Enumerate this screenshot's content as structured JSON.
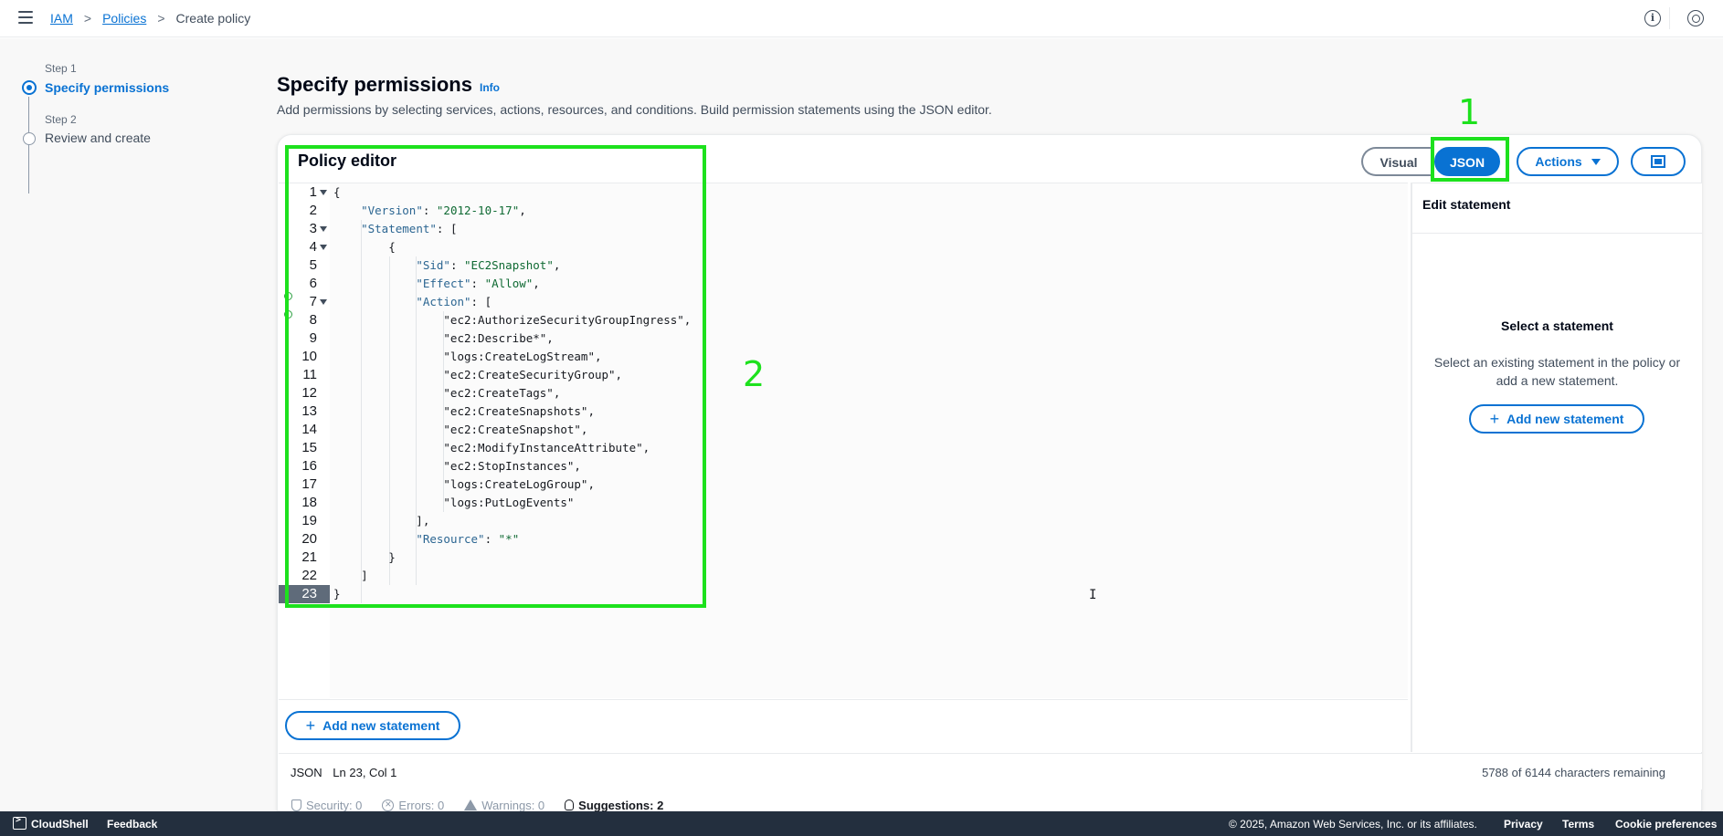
{
  "breadcrumb": {
    "items": [
      {
        "label": "IAM"
      },
      {
        "label": "Policies"
      },
      {
        "label": "Create policy"
      }
    ]
  },
  "icons": {
    "menu": "hamburger-icon",
    "info": "info-icon",
    "settings": "settings-icon"
  },
  "steps": [
    {
      "small": "Step 1",
      "label": "Specify permissions",
      "state": "active"
    },
    {
      "small": "Step 2",
      "label": "Review and create",
      "state": "inactive"
    }
  ],
  "header": {
    "title": "Specify permissions",
    "info": "Info",
    "description": "Add permissions by selecting services, actions, resources, and conditions. Build permission statements using the JSON editor."
  },
  "editor": {
    "title": "Policy editor",
    "visual_label": "Visual",
    "json_label": "JSON",
    "actions_label": "Actions",
    "add_statement_label": "Add new statement",
    "active_line": 23,
    "lines": [
      {
        "n": 1,
        "fold": true,
        "text": "{"
      },
      {
        "n": 2,
        "text": "    \"Version\": \"2012-10-17\","
      },
      {
        "n": 3,
        "fold": true,
        "text": "    \"Statement\": ["
      },
      {
        "n": 4,
        "fold": true,
        "text": "        {"
      },
      {
        "n": 5,
        "text": "            \"Sid\": \"EC2Snapshot\","
      },
      {
        "n": 6,
        "text": "            \"Effect\": \"Allow\","
      },
      {
        "n": 7,
        "fold": true,
        "text": "            \"Action\": ["
      },
      {
        "n": 8,
        "text": "                \"ec2:AuthorizeSecurityGroupIngress\","
      },
      {
        "n": 9,
        "text": "                \"ec2:Describe*\","
      },
      {
        "n": 10,
        "text": "                \"logs:CreateLogStream\","
      },
      {
        "n": 11,
        "text": "                \"ec2:CreateSecurityGroup\","
      },
      {
        "n": 12,
        "text": "                \"ec2:CreateTags\","
      },
      {
        "n": 13,
        "text": "                \"ec2:CreateSnapshots\","
      },
      {
        "n": 14,
        "text": "                \"ec2:CreateSnapshot\","
      },
      {
        "n": 15,
        "text": "                \"ec2:ModifyInstanceAttribute\","
      },
      {
        "n": 16,
        "text": "                \"ec2:StopInstances\","
      },
      {
        "n": 17,
        "text": "                \"logs:CreateLogGroup\","
      },
      {
        "n": 18,
        "text": "                \"logs:PutLogEvents\""
      },
      {
        "n": 19,
        "text": "            ],"
      },
      {
        "n": 20,
        "text": "            \"Resource\": \"*\""
      },
      {
        "n": 21,
        "text": "        }"
      },
      {
        "n": 22,
        "text": "    ]"
      },
      {
        "n": 23,
        "text": "}"
      }
    ]
  },
  "side_panel": {
    "title": "Edit statement",
    "empty_title": "Select a statement",
    "empty_desc": "Select an existing statement in the policy or add a new statement.",
    "add_label": "Add new statement"
  },
  "status": {
    "mode": "JSON",
    "position": "Ln 23, Col 1",
    "remaining": "5788 of 6144 characters remaining"
  },
  "checks": {
    "security": "Security: 0",
    "errors": "Errors: 0",
    "warnings": "Warnings: 0",
    "suggestions": "Suggestions: 2"
  },
  "footer": {
    "cloudshell": "CloudShell",
    "feedback": "Feedback",
    "copyright": "© 2025, Amazon Web Services, Inc. or its affiliates.",
    "privacy": "Privacy",
    "terms": "Terms",
    "cookies": "Cookie preferences"
  },
  "annotations": {
    "label_1": "1",
    "label_2": "2",
    "color": "#1de11d"
  },
  "colors": {
    "accent": "#0972d3",
    "footer_bg": "#232f3e",
    "json_key": "#2c6692",
    "json_string": "#0f6a33"
  }
}
